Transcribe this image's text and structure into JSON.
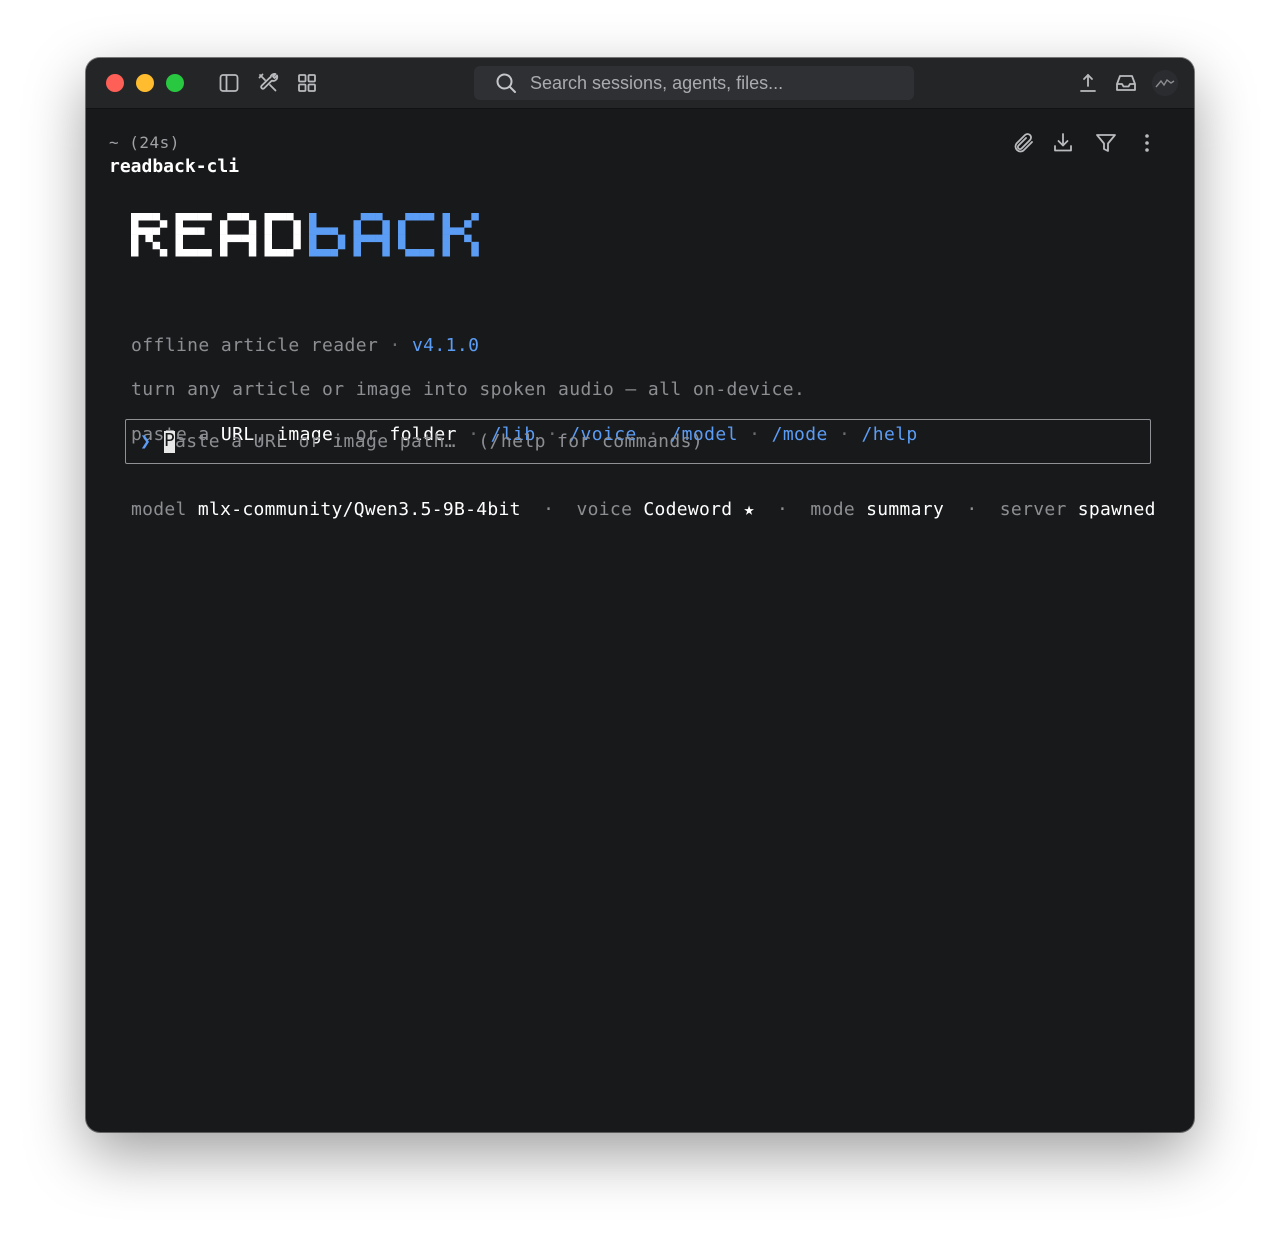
{
  "titlebar": {
    "search_placeholder": "Search sessions, agents, files..."
  },
  "icons": {
    "sidebar": "sidebar-toggle-icon",
    "tools": "tools-icon",
    "grid": "grid-icon",
    "upload": "upload-icon",
    "inbox": "inbox-icon",
    "attach": "paperclip-icon",
    "download": "download-icon",
    "filter": "filter-icon",
    "more": "more-vertical-icon"
  },
  "session": {
    "meta": "~ (24s)",
    "name": "readback-cli"
  },
  "logo": {
    "part1": "READ",
    "part2": "BACK",
    "color1": "#ffffff",
    "color2": "#5b9cf5"
  },
  "tagline": {
    "label": "offline article reader",
    "sep": " · ",
    "version": "v4.1.0"
  },
  "description": "turn any article or image into spoken audio — all on-device.",
  "hint": {
    "prefix": "paste a ",
    "url": "URL",
    "comma1": ", ",
    "image": "image",
    "or": ", or ",
    "folder": "folder",
    "commands": [
      "/lib",
      "/voice",
      "/model",
      "/mode",
      "/help"
    ],
    "sep": " · "
  },
  "prompt": {
    "caret": "❯",
    "first_char": "P",
    "placeholder_rest": "aste a URL or image path…  (/help for commands)"
  },
  "status": {
    "model_key": "model",
    "model_value": "mlx-community/Qwen3.5-9B-4bit",
    "voice_key": "voice",
    "voice_value": "Codeword ★",
    "mode_key": "mode",
    "mode_value": "summary",
    "server_key": "server",
    "server_value": "spawned",
    "sep": "·"
  },
  "colors": {
    "accent": "#5b9cf5",
    "window_bg": "#18191b",
    "titlebar_bg": "#242527"
  }
}
